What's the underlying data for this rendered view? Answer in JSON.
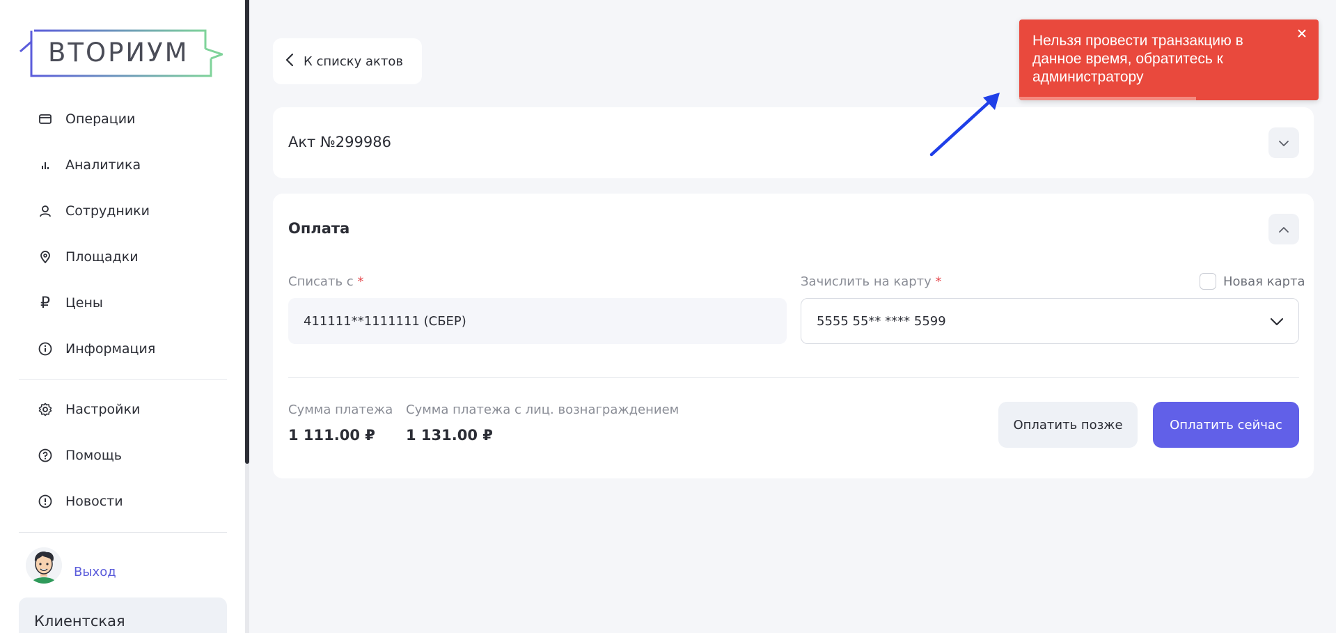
{
  "sidebar": {
    "logo_text": "ВТОРИУМ",
    "items": [
      {
        "label": "Операции",
        "icon": "card-icon"
      },
      {
        "label": "Аналитика",
        "icon": "bar-chart-icon"
      },
      {
        "label": "Сотрудники",
        "icon": "user-icon"
      },
      {
        "label": "Площадки",
        "icon": "location-pin-icon"
      },
      {
        "label": "Цены",
        "icon": "ruble-icon"
      },
      {
        "label": "Информация",
        "icon": "info-icon"
      }
    ],
    "items2": [
      {
        "label": "Настройки",
        "icon": "gear-icon"
      },
      {
        "label": "Помощь",
        "icon": "help-icon"
      },
      {
        "label": "Новости",
        "icon": "alert-circle-icon"
      }
    ],
    "logout_label": "Выход",
    "client_box_label": "Клиентская"
  },
  "back_button": {
    "label": "К списку актов"
  },
  "act_card": {
    "title": "Акт №299986"
  },
  "payment": {
    "title": "Оплата",
    "debit_label": "Списать с",
    "debit_value": "411111**1111111 (СБЕР)",
    "credit_label": "Зачислить на карту",
    "credit_value": "5555 55** **** 5599",
    "required_mark": "*",
    "new_card_label": "Новая карта",
    "sum_label": "Сумма платежа",
    "sum_value": "1 111.00 ₽",
    "sum_fee_label": "Сумма платежа с лиц. вознаграждением",
    "sum_fee_value": "1 131.00 ₽",
    "pay_later_label": "Оплатить позже",
    "pay_now_label": "Оплатить сейчас"
  },
  "toast": {
    "message": "Нельзя провести транзакцию в данное время, обратитесь к администратору",
    "progress": 0.59
  },
  "colors": {
    "accent": "#6160e8",
    "toast": "#e9493d",
    "annotation_arrow": "#1f3fe8"
  }
}
